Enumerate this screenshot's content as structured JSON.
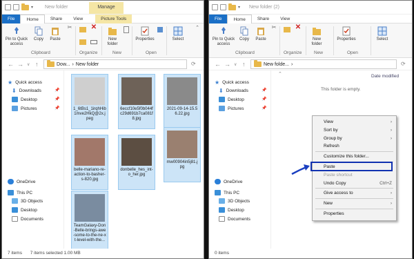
{
  "left": {
    "title": "New folder",
    "manage_label": "Manage",
    "tabs": [
      "File",
      "Home",
      "Share",
      "View",
      "Picture Tools"
    ],
    "ribbon": {
      "pin": "Pin to Quick access",
      "copy": "Copy",
      "paste": "Paste",
      "new_folder": "New folder",
      "properties": "Properties",
      "select": "Select",
      "groups": [
        "Clipboard",
        "Organize",
        "New",
        "Open"
      ]
    },
    "address": {
      "part1": "Dow...",
      "sep": "›",
      "part2": "New folder"
    },
    "nav": {
      "quick_access": "Quick access",
      "downloads": "Downloads",
      "desktop": "Desktop",
      "pictures": "Pictures",
      "onedrive": "OneDrive",
      "this_pc": "This PC",
      "objects3d": "3D Objects",
      "desktop2": "Desktop",
      "documents": "Documents"
    },
    "files": [
      "1_6tBs1_1irqhHib1mve2HkQ@2x.jpeg",
      "6eccf10e5f0b044fc29d691b7ca081f8.jpg",
      "2021-09-14-15.56.22.jpg",
      "belle-mariano-re-action-to-basher-s-820.jpg",
      "donbelle_hes_int-o_her.jpg",
      "mw00904in5j81.jpg",
      "TeamGalaxy-Don-Belle-brings-awe-some-to-the-ne-xt-level-with-the..."
    ],
    "status": {
      "items": "7 items",
      "selected": "7 items selected  1.00 MB"
    }
  },
  "right": {
    "title": "New folder (2)",
    "tabs": [
      "File",
      "Home",
      "Share",
      "View"
    ],
    "address": {
      "part1": "New folde...",
      "sep": "›"
    },
    "column_date": "Date modified",
    "empty_msg": "This folder is empty.",
    "status": {
      "items": "0 items"
    },
    "context_menu": {
      "view": "View",
      "sort_by": "Sort by",
      "group_by": "Group by",
      "refresh": "Refresh",
      "customize": "Customize this folder...",
      "paste": "Paste",
      "paste_shortcut": "Paste shortcut",
      "undo_copy": "Undo Copy",
      "undo_shortcut": "Ctrl+Z",
      "give_access": "Give access to",
      "new": "New",
      "properties": "Properties"
    }
  },
  "colors": {
    "accent": "#1a6fc6",
    "selection": "#cce4f7",
    "highlight_box": "#1031b0",
    "arrow": "#1a3fc0"
  }
}
